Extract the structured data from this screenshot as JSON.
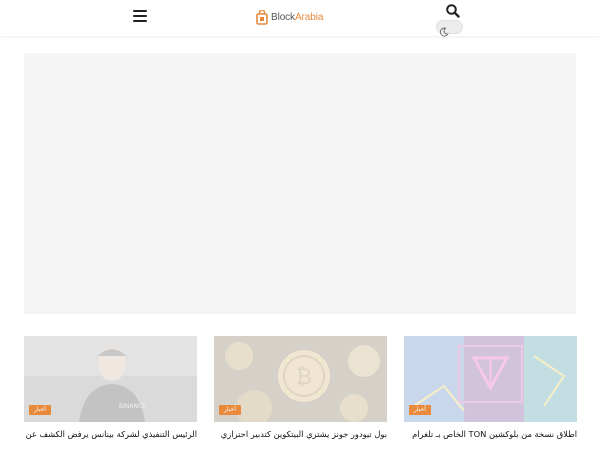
{
  "header": {
    "logo": {
      "text_primary": "Block",
      "text_accent": "Arabia"
    },
    "icons": {
      "menu": "hamburger-menu-icon",
      "search": "search-icon",
      "dark_mode": "moon-icon"
    }
  },
  "colors": {
    "accent": "#e8893b",
    "ad_placeholder": "#f5f5f5"
  },
  "articles": [
    {
      "category": "أخبار",
      "title": "اطلاق نسخة من بلوكشين TON الخاص بـ تلغرام"
    },
    {
      "category": "أخبار",
      "title": "بول تيودور جونز يشتري البيتكوين كتدبير احترازي"
    },
    {
      "category": "أخبار",
      "title": "الرئيس التنفيذي لشركة بينانس يرفض الكشف عن مقر"
    }
  ]
}
